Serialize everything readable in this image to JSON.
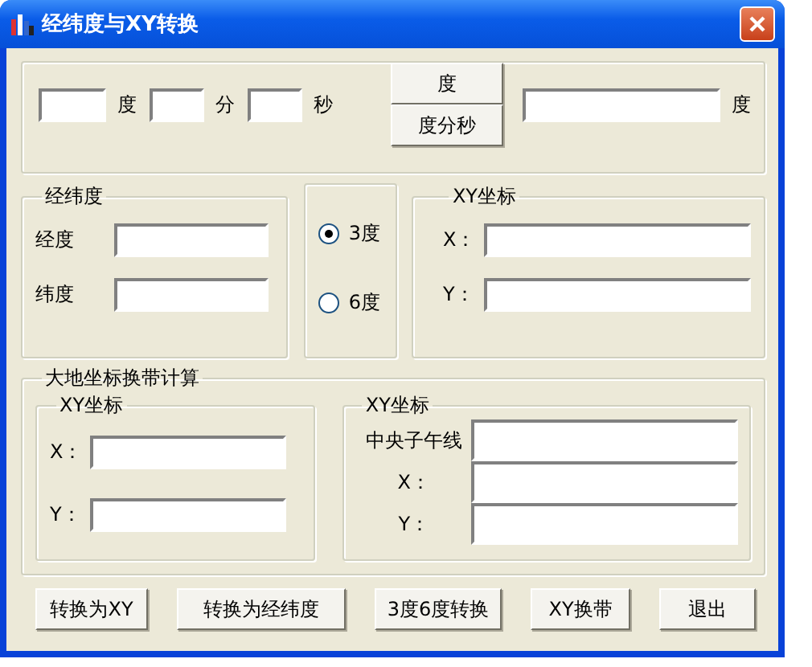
{
  "window": {
    "title": "经纬度与XY转换"
  },
  "dms": {
    "fields": [
      {
        "unit": "度"
      },
      {
        "unit": "分"
      },
      {
        "unit": "秒"
      }
    ],
    "buttons": [
      "度",
      "度分秒"
    ],
    "result_unit": "度"
  },
  "latlon": {
    "title": "经纬度",
    "fields": [
      {
        "label": "经度"
      },
      {
        "label": "纬度"
      }
    ]
  },
  "zone": {
    "options": [
      {
        "label": "3度",
        "selected": true
      },
      {
        "label": "6度",
        "selected": false
      }
    ]
  },
  "xy": {
    "title": "XY坐标",
    "fields": [
      {
        "label": "X："
      },
      {
        "label": "Y："
      }
    ]
  },
  "zone_change": {
    "title": "大地坐标换带计算",
    "source": {
      "title": "XY坐标",
      "fields": [
        {
          "label": "X："
        },
        {
          "label": "Y："
        }
      ]
    },
    "target": {
      "title": "XY坐标",
      "fields": [
        {
          "label": "中央子午线"
        },
        {
          "label": "X："
        },
        {
          "label": "Y："
        }
      ]
    }
  },
  "buttons": [
    "转换为XY",
    "转换为经纬度",
    "3度6度转换",
    "XY换带",
    "退出"
  ]
}
